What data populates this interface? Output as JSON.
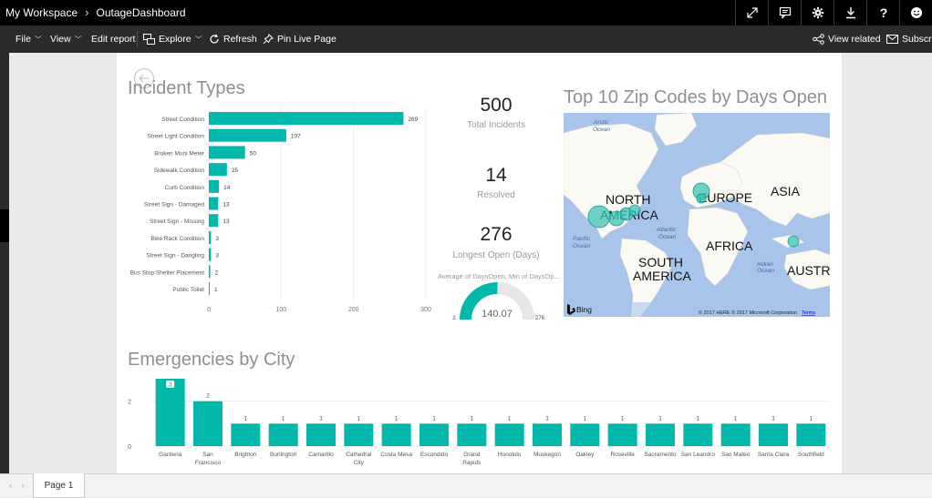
{
  "topbar": {
    "workspace": "My Workspace",
    "report": "OutageDashboard",
    "icons": [
      "expand-icon",
      "comment-icon",
      "gear-icon",
      "download-icon",
      "help-icon",
      "smiley-icon"
    ]
  },
  "toolbar": {
    "file": "File",
    "view": "View",
    "edit_report": "Edit report",
    "explore": "Explore",
    "refresh": "Refresh",
    "pin_live": "Pin Live Page",
    "view_related": "View related",
    "subscribe": "Subscrib"
  },
  "incident_chart": {
    "title": "Incident Types",
    "chart_data": {
      "type": "bar",
      "orientation": "horizontal",
      "categories": [
        "Street Condition",
        "Street Light Condition",
        "Broken Muni Meter",
        "Sidewalk Condition",
        "Curb Condition",
        "Street Sign - Damaged",
        "Street Sign - Missing",
        "Bike Rack Condition",
        "Street Sign - Dangling",
        "Bus Stop Shelter Placement",
        "Public Toilet"
      ],
      "values": [
        269,
        107,
        50,
        25,
        14,
        13,
        13,
        3,
        3,
        2,
        1
      ],
      "xlim": [
        0,
        300
      ],
      "xticks": [
        0,
        100,
        200,
        300
      ],
      "bar_color": "#01b8aa"
    }
  },
  "kpis": [
    {
      "value": "500",
      "label": "Total Incidents"
    },
    {
      "value": "14",
      "label": "Resolved"
    },
    {
      "value": "276",
      "label": "Longest Open (Days)"
    }
  ],
  "gauge": {
    "title": "Average of DaysOpen, Min of DaysOp...",
    "min": "2",
    "max": "276",
    "value": "140.07",
    "fraction": 0.504,
    "color": "#01b8aa"
  },
  "map": {
    "title": "Top 10 Zip Codes by Days Open",
    "labels": {
      "arctic": "Arctic",
      "arctic2": "Ocean",
      "north": "NORTH",
      "america": "AMERICA",
      "europe": "EUROPE",
      "asia": "ASIA",
      "africa": "AFRICA",
      "south": "SOUTH",
      "america2": "AMERICA",
      "austra": "AUSTRA",
      "atlantic": "Atlantic",
      "atlantic2": "Ocean",
      "pacific": "Pacific",
      "pacific2": "Ocean",
      "indian": "Indian",
      "indian2": "Ocean",
      "bing": "Bing",
      "copyright": "© 2017 HERE © 2017 Microsoft Corporation",
      "terms": "Terms"
    }
  },
  "city_chart": {
    "title": "Emergencies by City",
    "chart_data": {
      "type": "bar",
      "categories": [
        "Gardena",
        "San Francisco",
        "Brighton",
        "Burlington",
        "Camarillo",
        "Cathedral City",
        "Costa Mesa",
        "Escondido",
        "Grand Rapids",
        "Honolulu",
        "Muskegon",
        "Oakley",
        "Roseville",
        "Sacramento",
        "San Leandro",
        "San Mateo",
        "Santa Clara",
        "Southfield"
      ],
      "category_lines": [
        [
          "Gardena"
        ],
        [
          "San",
          "Francisco"
        ],
        [
          "Brighton"
        ],
        [
          "Burlington"
        ],
        [
          "Camarillo"
        ],
        [
          "Cathedral",
          "City"
        ],
        [
          "Costa Mesa"
        ],
        [
          "Escondido"
        ],
        [
          "Grand",
          "Rapids"
        ],
        [
          "Honolulu"
        ],
        [
          "Muskegon"
        ],
        [
          "Oakley"
        ],
        [
          "Roseville"
        ],
        [
          "Sacramento"
        ],
        [
          "San Leandro"
        ],
        [
          "San Mateo"
        ],
        [
          "Santa Clara"
        ],
        [
          "Southfield"
        ]
      ],
      "values": [
        3,
        2,
        1,
        1,
        1,
        1,
        1,
        1,
        1,
        1,
        1,
        1,
        1,
        1,
        1,
        1,
        1,
        1
      ],
      "ylim": [
        0,
        3
      ],
      "yticks": [
        0,
        2
      ],
      "bar_color": "#01b8aa"
    }
  },
  "bottom": {
    "page_tab": "Page 1"
  }
}
